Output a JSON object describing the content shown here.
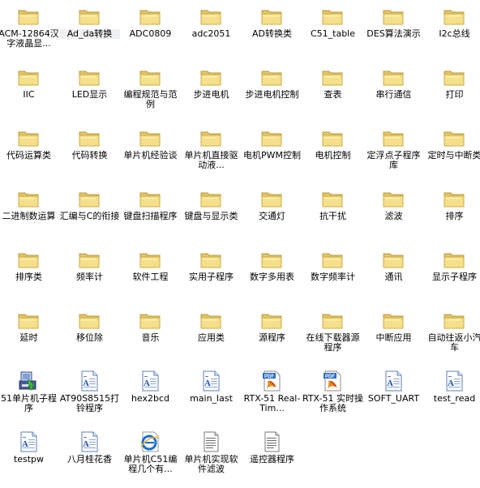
{
  "items": [
    {
      "label": "ACM-12864汉字液晶显...",
      "icon": "folder-icon"
    },
    {
      "label": "Ad_da转换",
      "icon": "folder-icon",
      "selected": true
    },
    {
      "label": "ADC0809",
      "icon": "folder-icon"
    },
    {
      "label": "adc2051",
      "icon": "folder-icon"
    },
    {
      "label": "AD转换类",
      "icon": "folder-icon"
    },
    {
      "label": "C51_table",
      "icon": "folder-icon"
    },
    {
      "label": "DES算法演示",
      "icon": "folder-icon"
    },
    {
      "label": "I2c总线",
      "icon": "folder-icon"
    },
    {
      "label": "IIC",
      "icon": "folder-icon"
    },
    {
      "label": "LED显示",
      "icon": "folder-icon"
    },
    {
      "label": "编程规范与范例",
      "icon": "folder-icon"
    },
    {
      "label": "步进电机",
      "icon": "folder-icon"
    },
    {
      "label": "步进电机控制",
      "icon": "folder-icon"
    },
    {
      "label": "查表",
      "icon": "folder-icon"
    },
    {
      "label": "串行通信",
      "icon": "folder-icon"
    },
    {
      "label": "打印",
      "icon": "folder-icon"
    },
    {
      "label": "代码运算类",
      "icon": "folder-icon"
    },
    {
      "label": "代码转换",
      "icon": "folder-icon"
    },
    {
      "label": "单片机经验谈",
      "icon": "folder-icon"
    },
    {
      "label": "单片机直接驱动液...",
      "icon": "folder-icon"
    },
    {
      "label": "电机PWM控制",
      "icon": "folder-icon"
    },
    {
      "label": "电机控制",
      "icon": "folder-icon"
    },
    {
      "label": "定浮点子程序库",
      "icon": "folder-icon"
    },
    {
      "label": "定时与中断类",
      "icon": "folder-icon"
    },
    {
      "label": "二进制数运算",
      "icon": "folder-icon"
    },
    {
      "label": "汇编与C的衔接",
      "icon": "folder-icon"
    },
    {
      "label": "键盘扫描程序",
      "icon": "folder-icon"
    },
    {
      "label": "键盘与显示类",
      "icon": "folder-icon"
    },
    {
      "label": "交通灯",
      "icon": "folder-icon"
    },
    {
      "label": "抗干扰",
      "icon": "folder-icon"
    },
    {
      "label": "滤波",
      "icon": "folder-icon"
    },
    {
      "label": "排序",
      "icon": "folder-icon"
    },
    {
      "label": "排序类",
      "icon": "folder-icon"
    },
    {
      "label": "频率计",
      "icon": "folder-icon"
    },
    {
      "label": "软件工程",
      "icon": "folder-icon"
    },
    {
      "label": "实用子程序",
      "icon": "folder-icon"
    },
    {
      "label": "数字多用表",
      "icon": "folder-icon"
    },
    {
      "label": "数字频率计",
      "icon": "folder-icon"
    },
    {
      "label": "通讯",
      "icon": "folder-icon"
    },
    {
      "label": "显示子程序",
      "icon": "folder-icon"
    },
    {
      "label": "延时",
      "icon": "folder-icon"
    },
    {
      "label": "移位除",
      "icon": "folder-icon"
    },
    {
      "label": "音乐",
      "icon": "folder-icon"
    },
    {
      "label": "应用类",
      "icon": "folder-icon"
    },
    {
      "label": "源程序",
      "icon": "folder-icon"
    },
    {
      "label": "在线下载器源程序",
      "icon": "folder-icon"
    },
    {
      "label": "中断应用",
      "icon": "folder-icon"
    },
    {
      "label": "自动往返小汽车",
      "icon": "folder-icon"
    },
    {
      "label": "51单片机子程序",
      "icon": "installer-icon"
    },
    {
      "label": "AT90S8515打铃程序",
      "icon": "document-icon"
    },
    {
      "label": "hex2bcd",
      "icon": "document-icon"
    },
    {
      "label": "main_last",
      "icon": "document-icon"
    },
    {
      "label": "RTX-51 Real-Tim...",
      "icon": "pdf-icon"
    },
    {
      "label": "RTX-51 实时操作系统",
      "icon": "pdf-icon"
    },
    {
      "label": "SOFT_UART",
      "icon": "document-icon"
    },
    {
      "label": "test_read",
      "icon": "document-icon"
    },
    {
      "label": "testpw",
      "icon": "document-icon"
    },
    {
      "label": "八月桂花香",
      "icon": "document-icon"
    },
    {
      "label": "单片机C51编程几个有...",
      "icon": "ie-icon"
    },
    {
      "label": "单片机实现软件滤波",
      "icon": "text-icon"
    },
    {
      "label": "遥控器程序",
      "icon": "text-icon"
    }
  ]
}
